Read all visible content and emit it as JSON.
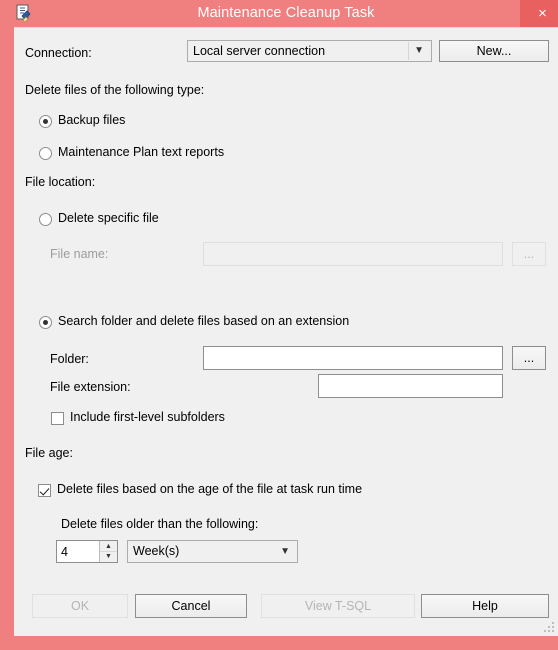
{
  "window": {
    "title": "Maintenance Cleanup Task",
    "icon": "maintenance-cleanup-task-icon",
    "close_label": "×",
    "accent_color": "#f08080",
    "close_color": "#e8605f",
    "client_bg": "#f0f0f0"
  },
  "connection": {
    "label": "Connection:",
    "value": "Local server connection",
    "new_button": "New...",
    "dropdown_icon": "chevron-down-icon"
  },
  "file_type": {
    "group_label": "Delete files of the following type:",
    "options": [
      {
        "label": "Backup files",
        "checked": true
      },
      {
        "label": "Maintenance Plan text reports",
        "checked": false
      }
    ]
  },
  "file_location": {
    "group_label": "File location:",
    "specific_file": {
      "label": "Delete specific file",
      "checked": false,
      "file_name_label": "File name:",
      "file_name_value": "",
      "file_name_placeholder": "",
      "browse_button": "...",
      "enabled": false
    },
    "search_folder": {
      "label": "Search folder and delete files based on an extension",
      "checked": true,
      "folder_label": "Folder:",
      "folder_value": "",
      "folder_placeholder": "",
      "browse_button": "...",
      "extension_label": "File extension:",
      "extension_value": "",
      "extension_placeholder": "",
      "include_subfolders_label": "Include first-level subfolders",
      "include_subfolders_checked": false
    }
  },
  "file_age": {
    "group_label": "File age:",
    "delete_by_age_label": "Delete files based on the age of the file at task run time",
    "delete_by_age_checked": true,
    "older_than_label": "Delete files older than the following:",
    "amount_value": "4",
    "unit_value": "Week(s)",
    "unit_icon": "chevron-down-icon",
    "spinner_up_icon": "spinner-up-arrow-icon",
    "spinner_down_icon": "spinner-down-arrow-icon"
  },
  "footer": {
    "buttons": [
      {
        "label": "OK",
        "enabled": false
      },
      {
        "label": "Cancel",
        "enabled": true
      },
      {
        "label": "View T-SQL",
        "enabled": false
      },
      {
        "label": "Help",
        "enabled": true
      }
    ],
    "resize_grip": "resize-grip-icon"
  }
}
